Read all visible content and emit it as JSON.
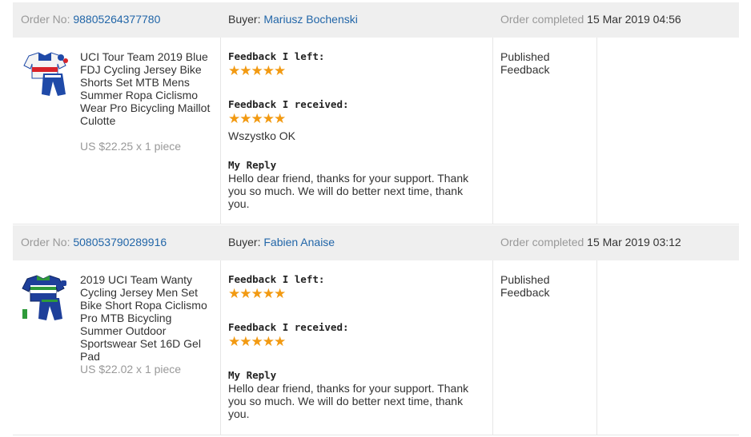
{
  "orders": [
    {
      "order_no_label": "Order No:",
      "order_no": "98805264377780",
      "buyer_label": "Buyer:",
      "buyer": "Mariusz Bochenski",
      "completed_label": "Order completed",
      "completed_date": "15 Mar 2019 04:56",
      "product_title": "UCI Tour Team 2019 Blue FDJ Cycling Jersey Bike Shorts Set MTB Mens Summer Ropa Ciclismo Wear Pro Bicycling Maillot Culotte",
      "price": "US $22.25 x 1 piece",
      "feedback_left_label": "Feedback I left:",
      "feedback_left_stars": "★★★★★",
      "feedback_received_label": "Feedback I received:",
      "feedback_received_stars": "★★★★★",
      "feedback_comment": "Wszystko OK",
      "reply_label": "My Reply",
      "reply_text": "Hello dear friend, thanks for your support. Thank you so much. We will do better next time, thank you.",
      "status": "Published Feedback",
      "thumb_icon": "cycling-kit-blue-red-image"
    },
    {
      "order_no_label": "Order No:",
      "order_no": "508053790289916",
      "buyer_label": "Buyer:",
      "buyer": "Fabien Anaise",
      "completed_label": "Order completed",
      "completed_date": "15 Mar 2019 03:12",
      "product_title": "2019 UCI Team Wanty Cycling Jersey Men Set Bike Short Ropa Ciclismo Pro MTB Bicycling Summer Outdoor Sportswear Set 16D Gel Pad",
      "price": "US $22.02 x 1 piece",
      "feedback_left_label": "Feedback I left:",
      "feedback_left_stars": "★★★★★",
      "feedback_received_label": "Feedback I received:",
      "feedback_received_stars": "★★★★★",
      "reply_label": "My Reply",
      "reply_text": "Hello dear friend, thanks for your support. Thank you so much. We will do better next time, thank you.",
      "status": "Published Feedback",
      "thumb_icon": "cycling-kit-green-blue-image"
    }
  ],
  "colors": {
    "link": "#2266a8",
    "star": "#f29a12",
    "header_bg": "#efefef",
    "muted": "#999999"
  }
}
